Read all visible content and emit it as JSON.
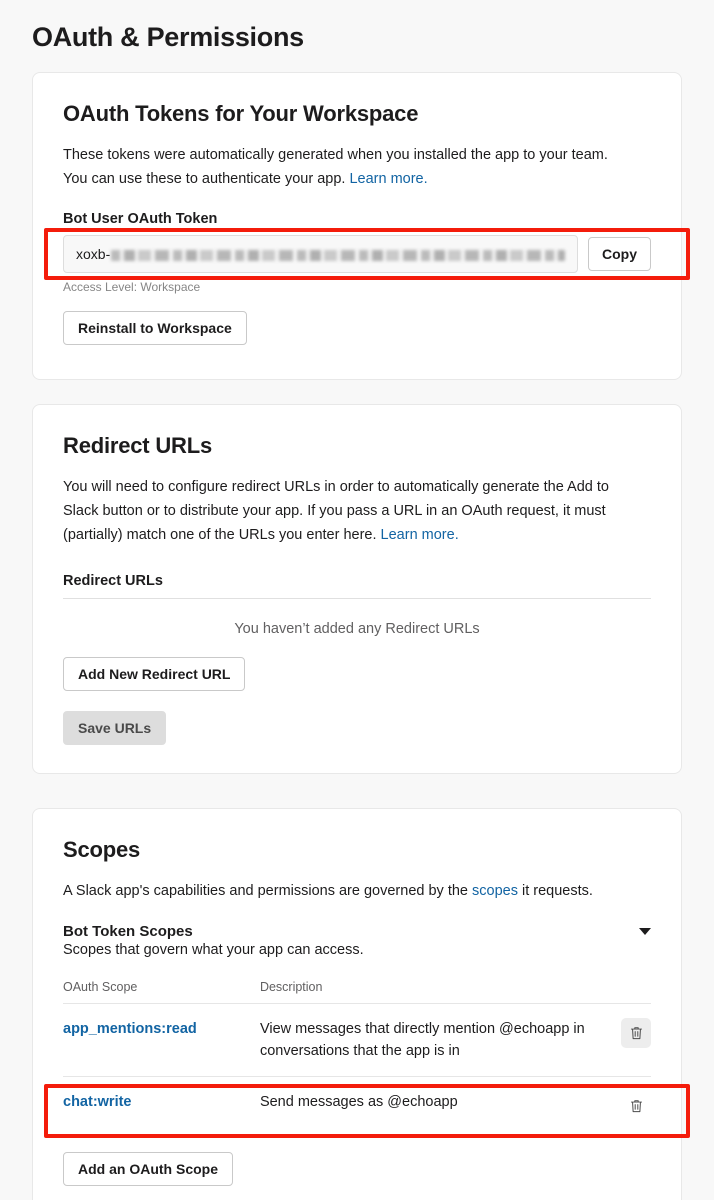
{
  "page": {
    "title": "OAuth & Permissions",
    "background_color": "#f8f8f8",
    "link_color": "#1264a3",
    "highlight_color": "#f41c0b"
  },
  "tokens_section": {
    "title": "OAuth Tokens for Your Workspace",
    "description_line1": "These tokens were automatically generated when you installed the app to your team.",
    "description_line2": "You can use these to authenticate your app. ",
    "learn_more_label": "Learn more.",
    "token_field_label": "Bot User OAuth Token",
    "token_value_prefix": "xoxb-",
    "token_value_masked": "xoxb-••••••••••••••••••••••••••••••••••••••••••••••••",
    "copy_button_label": "Copy",
    "access_level_text": "Access Level: Workspace",
    "reinstall_button_label": "Reinstall to Workspace"
  },
  "redirect_section": {
    "title": "Redirect URLs",
    "description_line1": "You will need to configure redirect URLs in order to automatically generate the Add to",
    "description_line2": "Slack button or to distribute your app. If you pass a URL in an OAuth request, it must",
    "description_line3": "(partially) match one of the URLs you enter here. ",
    "learn_more_label": "Learn more.",
    "list_label": "Redirect URLs",
    "empty_state_text": "You haven’t added any Redirect URLs",
    "add_button_label": "Add New Redirect URL",
    "save_button_label": "Save URLs"
  },
  "scopes_section": {
    "title": "Scopes",
    "description_prefix": "A Slack app's capabilities and permissions are governed by the ",
    "scopes_link_label": "scopes",
    "description_suffix": " it requests.",
    "bot_token_scopes_title": "Bot Token Scopes",
    "bot_token_scopes_subtitle": "Scopes that govern what your app can access.",
    "collapse_icon": "chevron-down-icon",
    "table": {
      "columns": [
        "OAuth Scope",
        "Description"
      ],
      "rows": [
        {
          "scope": "app_mentions:read",
          "description": "View messages that directly mention @echoapp in conversations that the app is in",
          "delete_icon": "trash-icon",
          "delete_hovered": true,
          "highlighted": false
        },
        {
          "scope": "chat:write",
          "description": "Send messages as @echoapp",
          "delete_icon": "trash-icon",
          "delete_hovered": false,
          "highlighted": true
        }
      ]
    },
    "add_scope_button_label": "Add an OAuth Scope"
  }
}
